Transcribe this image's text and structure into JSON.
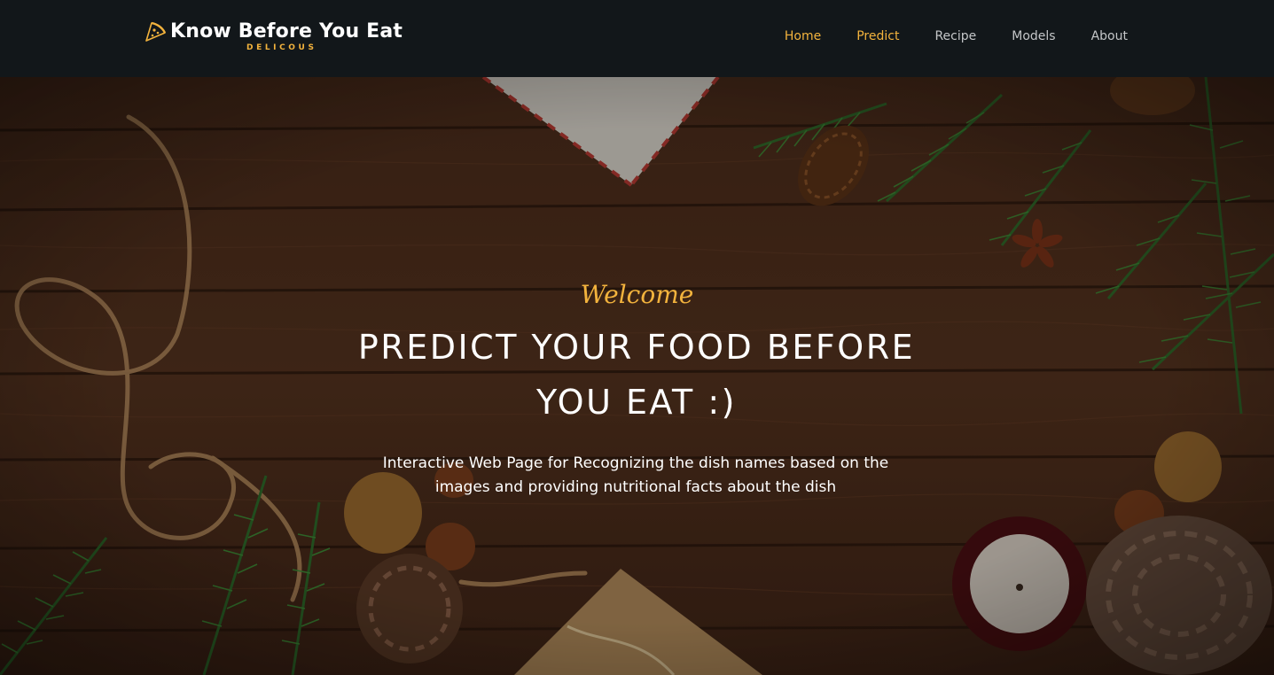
{
  "brand": {
    "title": "Know Before You Eat",
    "subtitle": "DELICOUS",
    "icon": "pizza-slice-icon",
    "accent_color": "#f3b33d"
  },
  "nav": {
    "items": [
      {
        "label": "Home",
        "active": true
      },
      {
        "label": "Predict",
        "active": true
      },
      {
        "label": "Recipe",
        "active": false
      },
      {
        "label": "Models",
        "active": false
      },
      {
        "label": "About",
        "active": false
      }
    ]
  },
  "hero": {
    "welcome": "Welcome",
    "headline": "Predict your food before you eat :)",
    "subtitle": "Interactive Web Page for Recognizing the dish names based on the images and providing nutritional facts about the dish"
  }
}
